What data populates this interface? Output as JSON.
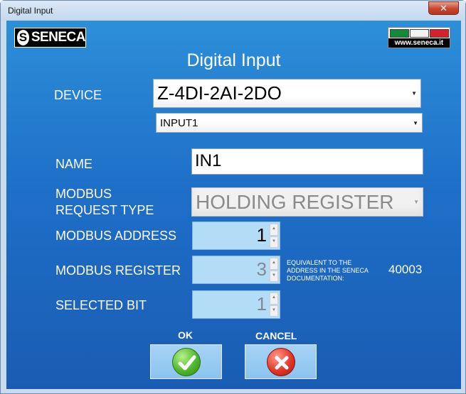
{
  "window": {
    "title": "Digital Input",
    "close_glyph": "✕"
  },
  "logos": {
    "seneca_letter": "S",
    "seneca_text": "SENECA",
    "website": "www.seneca.it",
    "flag_colors": [
      "#128a3a",
      "#f3f3f3",
      "#d8222b"
    ]
  },
  "dialog": {
    "title": "Digital Input"
  },
  "form": {
    "device_label": "DEVICE",
    "device_value": "Z-4DI-2AI-2DO",
    "input_value": "INPUT1",
    "name_label": "NAME",
    "name_value": "IN1",
    "request_type_label_line1": "MODBUS",
    "request_type_label_line2": "REQUEST TYPE",
    "request_type_value": "HOLDING REGISTER",
    "address_label": "MODBUS ADDRESS",
    "address_value": "1",
    "register_label": "MODBUS REGISTER",
    "register_value": "3",
    "equivalent_note": "EQUIVALENT TO THE ADDRESS IN THE SENECA DOCUMENTATION:",
    "equivalent_value": "40003",
    "bit_label": "SELECTED BIT",
    "bit_value": "1"
  },
  "buttons": {
    "ok_label": "OK",
    "cancel_label": "CANCEL"
  },
  "icons": {
    "ok": "checkmark-icon",
    "cancel": "x-mark-icon",
    "dropdown": "chevron-down-icon",
    "spin_up": "spin-up-icon",
    "spin_down": "spin-down-icon"
  },
  "colors": {
    "background_top": "#2d8fd9",
    "background_bottom": "#1a5cb3",
    "ok_green": "#4fb82c",
    "cancel_red": "#e2382a"
  }
}
